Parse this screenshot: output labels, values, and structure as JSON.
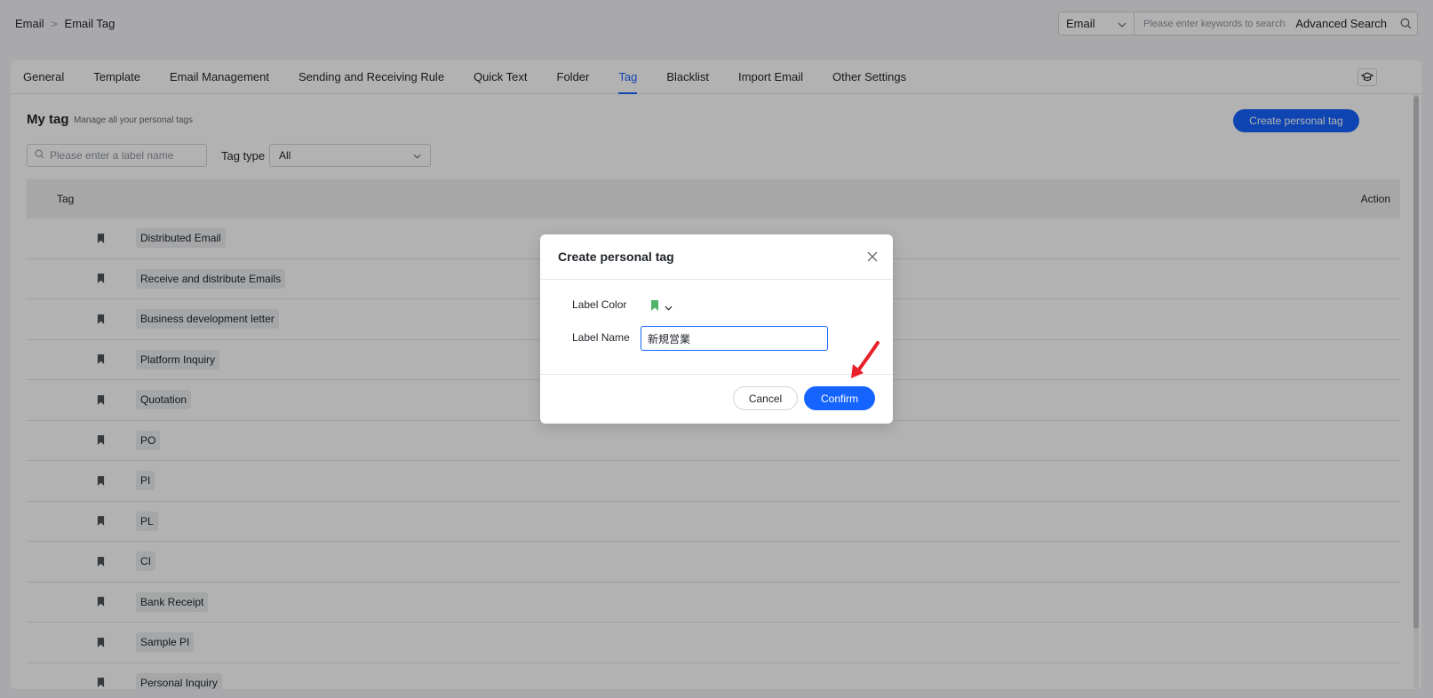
{
  "breadcrumb": {
    "root": "Email",
    "separator": ">",
    "current": "Email Tag"
  },
  "search": {
    "scope": "Email",
    "placeholder": "Please enter keywords to search",
    "advanced_label": "Advanced Search"
  },
  "tabs": [
    {
      "label": "General"
    },
    {
      "label": "Template"
    },
    {
      "label": "Email Management"
    },
    {
      "label": "Sending and Receiving Rule"
    },
    {
      "label": "Quick Text"
    },
    {
      "label": "Folder"
    },
    {
      "label": "Tag",
      "active": true
    },
    {
      "label": "Blacklist"
    },
    {
      "label": "Import Email"
    },
    {
      "label": "Other Settings"
    }
  ],
  "mytag": {
    "title": "My tag",
    "subtitle": "Manage all your personal tags",
    "create_label": "Create personal tag"
  },
  "filter": {
    "placeholder": "Please enter a label name",
    "tag_type_label": "Tag type",
    "tag_type_value": "All"
  },
  "table": {
    "headers": {
      "tag": "Tag",
      "action": "Action"
    },
    "rows": [
      {
        "name": "Distributed Email"
      },
      {
        "name": "Receive and distribute Emails"
      },
      {
        "name": "Business development letter"
      },
      {
        "name": "Platform Inquiry"
      },
      {
        "name": "Quotation"
      },
      {
        "name": "PO"
      },
      {
        "name": "PI"
      },
      {
        "name": "PL"
      },
      {
        "name": "CI"
      },
      {
        "name": "Bank Receipt"
      },
      {
        "name": "Sample PI"
      },
      {
        "name": "Personal Inquiry"
      }
    ]
  },
  "modal": {
    "title": "Create personal tag",
    "label_color": "Label Color",
    "color": "#52b36a",
    "label_name": "Label Name",
    "name_value": "新規営業",
    "cancel": "Cancel",
    "confirm": "Confirm"
  },
  "colors": {
    "accent": "#1664ff",
    "arrow": "#e8202a",
    "bookmark": "#4e5358"
  }
}
